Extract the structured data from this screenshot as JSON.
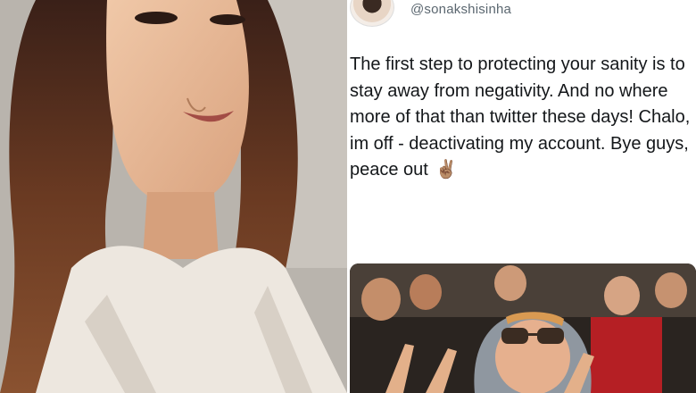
{
  "tweet": {
    "handle": "@sonakshisinha",
    "text": "The first step to protecting your sanity is to stay away from negativity. And no where more of that than twitter these days! Chalo, im off - deactivating my account. Bye guys, peace out",
    "emoji": "✌🏽"
  },
  "images": {
    "left_photo": "portrait-photo",
    "gif": "audience-peace-sign-gif"
  }
}
